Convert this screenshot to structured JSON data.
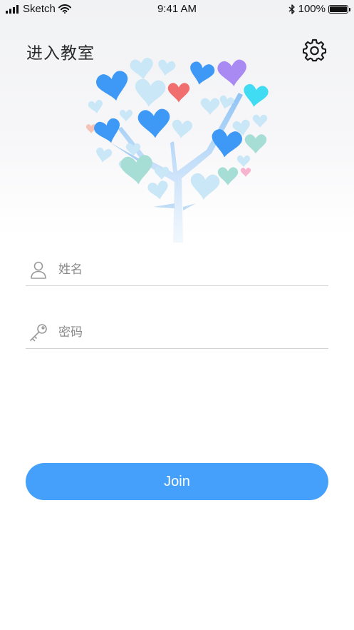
{
  "status_bar": {
    "carrier": "Sketch",
    "time": "9:41 AM",
    "battery_percent": "100%",
    "battery_level": 1.0,
    "icons": [
      "signal-bars-icon",
      "wifi-icon",
      "bluetooth-icon",
      "battery-icon"
    ]
  },
  "header": {
    "title": "进入教室",
    "settings_icon": "gear-icon"
  },
  "illustration": {
    "name": "heart-tree-illustration",
    "colors": {
      "trunk": "#8ec3f5",
      "blue": "#3d99f5",
      "light_blue": "#c9e7f7",
      "red": "#f06e6e",
      "purple": "#a98af2",
      "cyan": "#3fdcf4",
      "mint": "#a6ded6",
      "pink": "#f6b4cf"
    }
  },
  "form": {
    "name_field": {
      "placeholder": "姓名",
      "value": "",
      "icon": "user-icon"
    },
    "password_field": {
      "placeholder": "密码",
      "value": "",
      "icon": "key-icon"
    }
  },
  "join_button": {
    "label": "Join"
  },
  "colors": {
    "accent": "#44a0fb",
    "divider": "#d3d3d3",
    "placeholder": "#8a8a8a"
  }
}
